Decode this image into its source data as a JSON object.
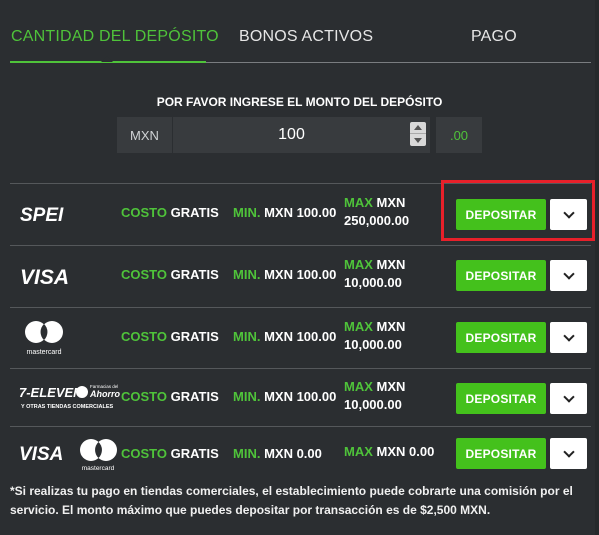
{
  "tabs": [
    {
      "label": "CANTIDAD DEL DEPÓSITO",
      "active": true
    },
    {
      "label": "BONOS ACTIVOS",
      "active": false
    },
    {
      "label": "PAGO",
      "active": false
    }
  ],
  "deposit_form": {
    "prompt": "POR FAVOR INGRESE EL MONTO DEL DEPÓSITO",
    "currency": "MXN",
    "amount_value": "100",
    "decimals": ".00"
  },
  "methods": [
    {
      "logo": "spei-logo",
      "logo_text": "SPEI",
      "cost_label": "COSTO",
      "cost_value": "GRATIS",
      "min_label": "MIN.",
      "min_value": "MXN 100.00",
      "max_label": "MAX",
      "max_value_line1": "MXN",
      "max_value_line2": "250,000.00",
      "button_label": "DEPOSITAR"
    },
    {
      "logo": "visa-logo",
      "logo_text": "VISA",
      "cost_label": "COSTO",
      "cost_value": "GRATIS",
      "min_label": "MIN.",
      "min_value": "MXN 100.00",
      "max_label": "MAX",
      "max_value_line1": "MXN",
      "max_value_line2": "10,000.00",
      "button_label": "DEPOSITAR"
    },
    {
      "logo": "mastercard-logo",
      "logo_text": "mastercard",
      "cost_label": "COSTO",
      "cost_value": "GRATIS",
      "min_label": "MIN.",
      "min_value": "MXN 100.00",
      "max_label": "MAX",
      "max_value_line1": "MXN",
      "max_value_line2": "10,000.00",
      "button_label": "DEPOSITAR"
    },
    {
      "logo": "7-eleven-ahorro-logo",
      "logo_text": "7-ELEVEN",
      "logo_subtext": "Y OTRAS TIENDAS COMERCIALES",
      "logo_brand2": "Farmacias del Ahorro",
      "cost_label": "COSTO",
      "cost_value": "GRATIS",
      "min_label": "MIN.",
      "min_value": "MXN 100.00",
      "max_label": "MAX",
      "max_value_line1": "MXN",
      "max_value_line2": "10,000.00",
      "button_label": "DEPOSITAR"
    },
    {
      "logo": "visa-mastercard-logo",
      "logo_text": "VISA",
      "logo_text2": "mastercard",
      "cost_label": "COSTO",
      "cost_value": "GRATIS",
      "min_label": "MIN.",
      "min_value": "MXN 0.00",
      "max_label": "MAX",
      "max_value_line1": "MXN 0.00",
      "max_value_line2": "",
      "button_label": "DEPOSITAR"
    }
  ],
  "footnote": "*Si realizas tu pago en tiendas comerciales, el establecimiento puede cobrarte una comisión por el servicio. El monto máximo que puedes depositar por transacción es de $2,500 MXN.",
  "colors": {
    "background": "#2b2e31",
    "accent_green": "#4fc33a",
    "button_green": "#44c11c",
    "highlight_red": "#e8202a"
  }
}
